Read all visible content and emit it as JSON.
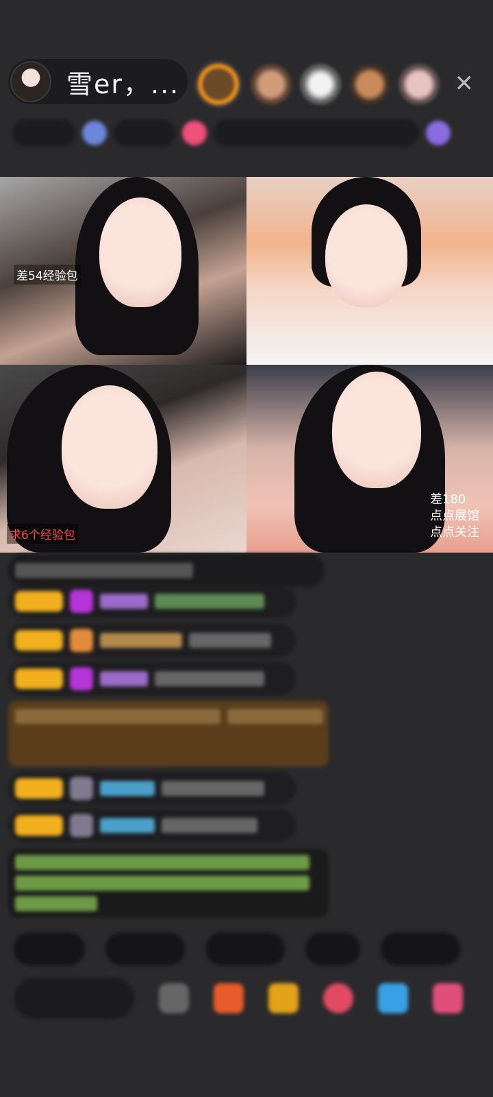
{
  "host": {
    "name": "雪er，..."
  },
  "icons": {
    "close": "close-icon"
  },
  "grid": {
    "tile1_label": "差54经验包",
    "tile3_label": "求6个经验包",
    "tile4_label_lines": [
      "差180",
      "点点展馆",
      "点点关注"
    ]
  }
}
